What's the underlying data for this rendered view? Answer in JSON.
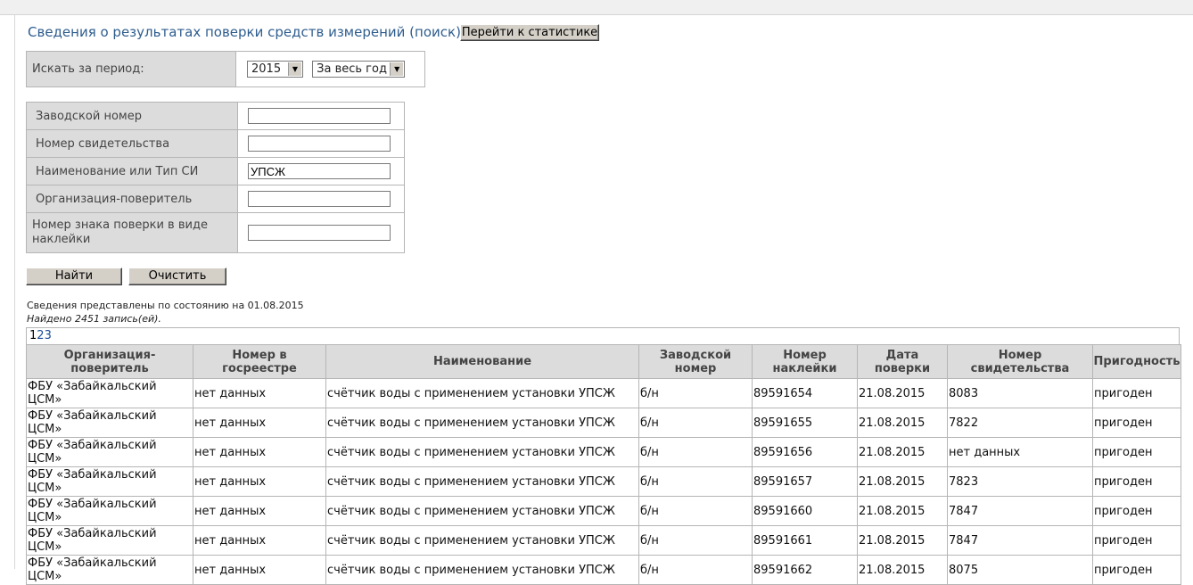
{
  "page": {
    "title": "Сведения о результатах поверки средств измерений (поиск)",
    "stats_button": "Перейти к статистике"
  },
  "period": {
    "label": "Искать за период:",
    "year": "2015",
    "range": "За весь год"
  },
  "filters": [
    {
      "label": "Заводской номер",
      "value": ""
    },
    {
      "label": "Номер свидетельства",
      "value": ""
    },
    {
      "label": "Наименование или Тип СИ",
      "value": "УПСЖ"
    },
    {
      "label": "Организация-поверитель",
      "value": ""
    },
    {
      "label": "Номер знака поверки в виде наклейки",
      "value": ""
    }
  ],
  "actions": {
    "find": "Найти",
    "clear": "Очистить"
  },
  "status": {
    "info": "Сведения представлены по состоянию на 01.08.2015",
    "found": "Найдено 2451 запись(ей)."
  },
  "pager": [
    "1",
    "2",
    "3"
  ],
  "results": {
    "columns": [
      "Организация-поверитель",
      "Номер в госреестре",
      "Наименование",
      "Заводской номер",
      "Номер наклейки",
      "Дата поверки",
      "Номер свидетельства",
      "Пригодность"
    ],
    "rows": [
      [
        "ФБУ «Забайкальский ЦСМ»",
        "нет данных",
        "счётчик воды с применением установки УПСЖ",
        "б/н",
        "89591654",
        "21.08.2015",
        "8083",
        "пригоден"
      ],
      [
        "ФБУ «Забайкальский ЦСМ»",
        "нет данных",
        "счётчик воды с применением установки УПСЖ",
        "б/н",
        "89591655",
        "21.08.2015",
        "7822",
        "пригоден"
      ],
      [
        "ФБУ «Забайкальский ЦСМ»",
        "нет данных",
        "счётчик воды с применением установки УПСЖ",
        "б/н",
        "89591656",
        "21.08.2015",
        "нет данных",
        "пригоден"
      ],
      [
        "ФБУ «Забайкальский ЦСМ»",
        "нет данных",
        "счётчик воды с применением установки УПСЖ",
        "б/н",
        "89591657",
        "21.08.2015",
        "7823",
        "пригоден"
      ],
      [
        "ФБУ «Забайкальский ЦСМ»",
        "нет данных",
        "счётчик воды с применением установки УПСЖ",
        "б/н",
        "89591660",
        "21.08.2015",
        "7847",
        "пригоден"
      ],
      [
        "ФБУ «Забайкальский ЦСМ»",
        "нет данных",
        "счётчик воды с применением установки УПСЖ",
        "б/н",
        "89591661",
        "21.08.2015",
        "7847",
        "пригоден"
      ],
      [
        "ФБУ «Забайкальский ЦСМ»",
        "нет данных",
        "счётчик воды с применением установки УПСЖ",
        "б/н",
        "89591662",
        "21.08.2015",
        "8075",
        "пригоден"
      ]
    ]
  }
}
